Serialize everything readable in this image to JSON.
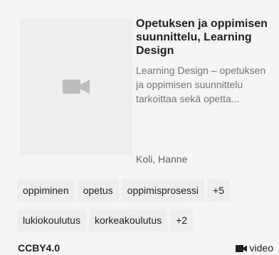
{
  "card": {
    "title": "Opetuksen ja oppimisen suunnittelu, Learning Design",
    "description": "Learning Design – opetuksen ja oppimisen suunnittelu tarkoittaa sekä opetta...",
    "author": "Koli, Hanne",
    "thumbnail_icon": "video-camera-icon",
    "tags_row1": [
      "oppiminen",
      "opetus",
      "oppimisprosessi",
      "+5"
    ],
    "tags_row2": [
      "lukiokoulutus",
      "korkeakoulutus",
      "+2"
    ],
    "license": "CCBY4.0",
    "type_label": "video",
    "type_icon": "video-camera-icon"
  },
  "colors": {
    "card_background": "#f5f5f5",
    "thumbnail_background": "#eeeeee",
    "icon_gray": "#bdbdbd",
    "chip_background": "#eeeeee"
  }
}
